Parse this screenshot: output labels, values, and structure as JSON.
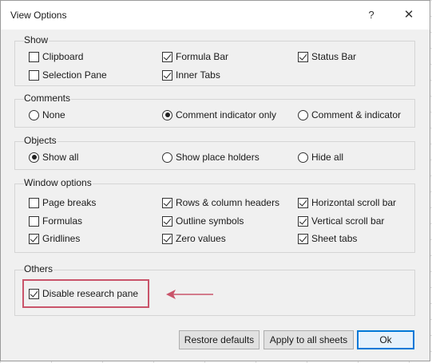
{
  "window": {
    "title": "View Options",
    "help_label": "?",
    "close_label": "✕"
  },
  "groups": {
    "show": {
      "label": "Show",
      "items": [
        {
          "label": "Clipboard",
          "checked": false
        },
        {
          "label": "Formula Bar",
          "checked": true
        },
        {
          "label": "Status Bar",
          "checked": true
        },
        {
          "label": "Selection Pane",
          "checked": false
        },
        {
          "label": "Inner Tabs",
          "checked": true
        }
      ]
    },
    "comments": {
      "label": "Comments",
      "items": [
        {
          "label": "None",
          "selected": false
        },
        {
          "label": "Comment indicator only",
          "selected": true
        },
        {
          "label": "Comment & indicator",
          "selected": false
        }
      ]
    },
    "objects": {
      "label": "Objects",
      "items": [
        {
          "label": "Show all",
          "selected": true
        },
        {
          "label": "Show place holders",
          "selected": false
        },
        {
          "label": "Hide all",
          "selected": false
        }
      ]
    },
    "window_options": {
      "label": "Window options",
      "items": [
        {
          "label": "Page breaks",
          "checked": false
        },
        {
          "label": "Rows & column headers",
          "checked": true
        },
        {
          "label": "Horizontal scroll bar",
          "checked": true
        },
        {
          "label": "Formulas",
          "checked": false
        },
        {
          "label": "Outline symbols",
          "checked": true
        },
        {
          "label": "Vertical scroll bar",
          "checked": true
        },
        {
          "label": "Gridlines",
          "checked": true
        },
        {
          "label": "Zero values",
          "checked": true
        },
        {
          "label": "Sheet tabs",
          "checked": true
        }
      ]
    },
    "others": {
      "label": "Others",
      "items": [
        {
          "label": "Disable research pane",
          "checked": true
        }
      ]
    }
  },
  "buttons": {
    "restore_defaults": "Restore defaults",
    "apply_all": "Apply to all sheets",
    "ok": "Ok"
  },
  "colors": {
    "highlight": "#c9546a",
    "dialog_bg": "#f0f0f0",
    "ok_border": "#0078d7"
  }
}
